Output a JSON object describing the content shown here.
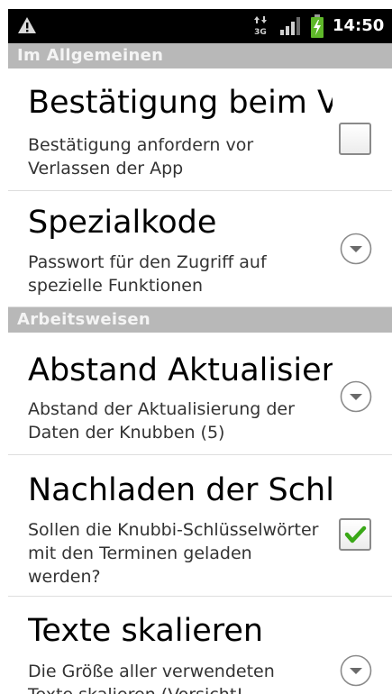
{
  "status_bar": {
    "time": "14:50",
    "network": "3G",
    "icons": [
      "warning-icon",
      "network-3g-icon",
      "signal-icon",
      "battery-charging-icon"
    ]
  },
  "colors": {
    "category_bg": "#b8b8b8",
    "checkbox_check": "#3aa817"
  },
  "categories": [
    {
      "label": "Im Allgemeinen"
    },
    {
      "label": "Arbeitsweisen"
    }
  ],
  "prefs": [
    {
      "title": "Bestätigung beim Verlassen",
      "summary": "Bestätigung anfordern vor Verlassen der App",
      "widget": "checkbox",
      "checked": false
    },
    {
      "title": "Spezialkode",
      "summary": "Passwort für den Zugriff auf spezielle Funktionen",
      "widget": "dropdown"
    },
    {
      "title": "Abstand Aktualisierung",
      "summary": "Abstand der Aktualisierung der Daten der Knubben (5)",
      "widget": "dropdown"
    },
    {
      "title": "Nachladen der Schlüsselwörter",
      "summary": "Sollen die Knubbi-Schlüsselwörter mit den Terminen geladen werden?",
      "widget": "checkbox",
      "checked": true
    },
    {
      "title": "Texte skalieren",
      "summary": "Die Größe aller verwendeten Texte skalieren (Vorsicht!",
      "widget": "dropdown"
    }
  ]
}
